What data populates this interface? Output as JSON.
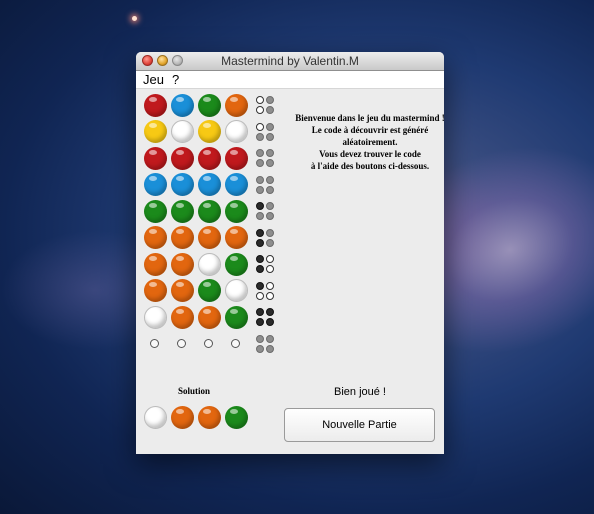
{
  "window": {
    "title": "Mastermind by Valentin.M"
  },
  "menu": {
    "items": [
      "Jeu",
      "?"
    ]
  },
  "colors": {
    "red": "#c0191d",
    "blue": "#1a8fd8",
    "green": "#1b8a1b",
    "orange": "#e2660f",
    "yellow": "#f7c914",
    "white": "#ffffff"
  },
  "board": {
    "rows": [
      {
        "pegs": [
          "red",
          "blue",
          "green",
          "orange"
        ],
        "feedback": [
          "w",
          "g",
          "w",
          "g"
        ]
      },
      {
        "pegs": [
          "yellow",
          "white",
          "yellow",
          "white"
        ],
        "feedback": [
          "w",
          "g",
          "g",
          "g"
        ]
      },
      {
        "pegs": [
          "red",
          "red",
          "red",
          "red"
        ],
        "feedback": [
          "g",
          "g",
          "g",
          "g"
        ]
      },
      {
        "pegs": [
          "blue",
          "blue",
          "blue",
          "blue"
        ],
        "feedback": [
          "g",
          "g",
          "g",
          "g"
        ]
      },
      {
        "pegs": [
          "green",
          "green",
          "green",
          "green"
        ],
        "feedback": [
          "b",
          "g",
          "g",
          "g"
        ]
      },
      {
        "pegs": [
          "orange",
          "orange",
          "orange",
          "orange"
        ],
        "feedback": [
          "b",
          "g",
          "b",
          "g"
        ]
      },
      {
        "pegs": [
          "orange",
          "orange",
          "white",
          "green"
        ],
        "feedback": [
          "b",
          "w",
          "b",
          "w"
        ]
      },
      {
        "pegs": [
          "orange",
          "orange",
          "green",
          "white"
        ],
        "feedback": [
          "b",
          "w",
          "w",
          "w"
        ]
      },
      {
        "pegs": [
          "white",
          "orange",
          "orange",
          "green"
        ],
        "feedback": [
          "b",
          "b",
          "b",
          "b"
        ]
      },
      {
        "pegs": [
          "empty",
          "empty",
          "empty",
          "empty"
        ],
        "feedback": [
          "g",
          "g",
          "g",
          "g"
        ]
      }
    ]
  },
  "welcome_text": "Bienvenue dans le jeu du mastermind !\nLe code à découvrir est généré\naléatoirement.\nVous devez trouver le code\nà l'aide des boutons ci-dessous.",
  "solution": {
    "label": "Solution",
    "pegs": [
      "white",
      "orange",
      "orange",
      "green"
    ]
  },
  "status": "Bien joué !",
  "new_game_button": "Nouvelle Partie"
}
